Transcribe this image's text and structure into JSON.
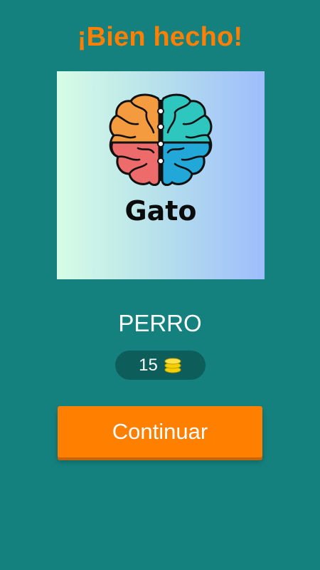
{
  "header": {
    "title": "¡Bien hecho!"
  },
  "image": {
    "icon": "brain-icon",
    "word": "Gato"
  },
  "answer": {
    "text": "PERRO"
  },
  "coins": {
    "value": "15",
    "icon": "coins-icon"
  },
  "actions": {
    "continue_label": "Continuar"
  },
  "colors": {
    "background": "#15817e",
    "accent": "#ff7f00",
    "badge": "#0d5e5b",
    "coin": "#f4d000"
  }
}
